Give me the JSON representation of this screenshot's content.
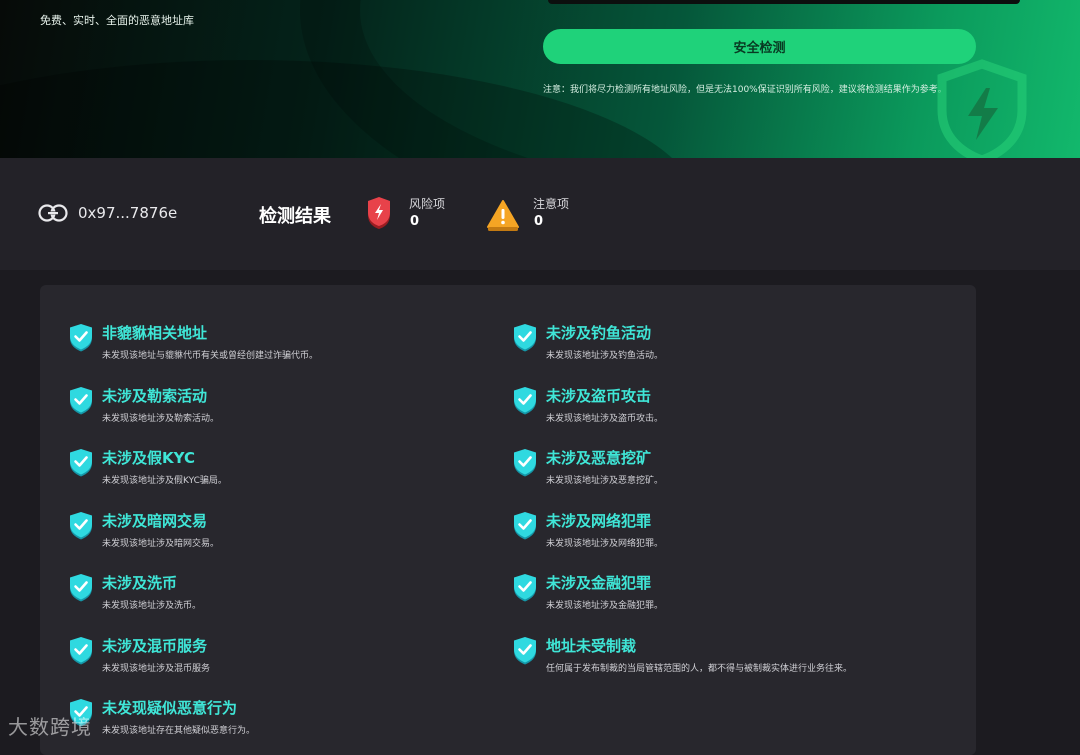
{
  "hero": {
    "tagline": "免费、实时、全面的恶意地址库",
    "check_button": "安全检测",
    "notice": "注意：我们将尽力检测所有地址风险，但是无法100%保证识别所有风险，建议将检测结果作为参考。"
  },
  "summary": {
    "address": "0x97...7876e",
    "result_title": "检测结果",
    "risk_label": "风险项",
    "risk_count": "0",
    "warn_label": "注意项",
    "warn_count": "0"
  },
  "results": {
    "left": [
      {
        "title": "非貔貅相关地址",
        "desc": "未发现该地址与貔貅代币有关或曾经创建过诈骗代币。"
      },
      {
        "title": "未涉及勒索活动",
        "desc": "未发现该地址涉及勒索活动。"
      },
      {
        "title": "未涉及假KYC",
        "desc": "未发现该地址涉及假KYC骗局。"
      },
      {
        "title": "未涉及暗网交易",
        "desc": "未发现该地址涉及暗网交易。"
      },
      {
        "title": "未涉及洗币",
        "desc": "未发现该地址涉及洗币。"
      },
      {
        "title": "未涉及混币服务",
        "desc": "未发现该地址涉及混币服务"
      },
      {
        "title": "未发现疑似恶意行为",
        "desc": "未发现该地址存在其他疑似恶意行为。"
      }
    ],
    "right": [
      {
        "title": "未涉及钓鱼活动",
        "desc": "未发现该地址涉及钓鱼活动。"
      },
      {
        "title": "未涉及盗币攻击",
        "desc": "未发现该地址涉及盗币攻击。"
      },
      {
        "title": "未涉及恶意挖矿",
        "desc": "未发现该地址涉及恶意挖矿。"
      },
      {
        "title": "未涉及网络犯罪",
        "desc": "未发现该地址涉及网络犯罪。"
      },
      {
        "title": "未涉及金融犯罪",
        "desc": "未发现该地址涉及金融犯罪。"
      },
      {
        "title": "地址未受制裁",
        "desc": "任何属于发布制裁的当局管辖范围的人，都不得与被制裁实体进行业务往来。"
      }
    ]
  },
  "watermark": "大数跨境",
  "colors": {
    "accent_green": "#1fd27a",
    "item_title": "#3fe6d7",
    "risk_red": "#e8424a",
    "warn_orange": "#f5a524"
  }
}
